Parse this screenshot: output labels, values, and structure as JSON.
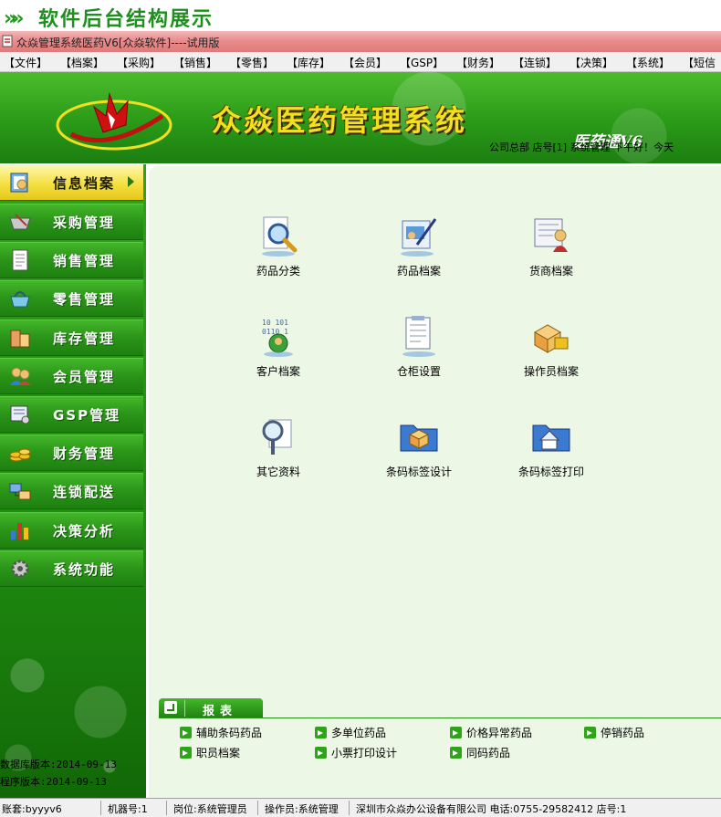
{
  "banner": {
    "chevrons": "»»",
    "title": "软件后台结构展示"
  },
  "window": {
    "title": "众焱管理系统医药V6[众焱软件]----试用版"
  },
  "menu": [
    "【文件】",
    "【档案】",
    "【采购】",
    "【销售】",
    "【零售】",
    "【库存】",
    "【会员】",
    "【GSP】",
    "【财务】",
    "【连锁】",
    "【决策】",
    "【系统】",
    "【短信"
  ],
  "header": {
    "system_name": "众焱医药管理系统",
    "edition": "医药通V6",
    "info": "公司总部  店号[1]  系统管理  下午好！今天"
  },
  "sidebar": {
    "items": [
      {
        "label": "信息档案",
        "icon": "archive-book-icon",
        "active": true
      },
      {
        "label": "采购管理",
        "icon": "shopping-basket-icon",
        "active": false
      },
      {
        "label": "销售管理",
        "icon": "document-icon",
        "active": false
      },
      {
        "label": "零售管理",
        "icon": "basket-icon",
        "active": false
      },
      {
        "label": "库存管理",
        "icon": "warehouse-icon",
        "active": false
      },
      {
        "label": "会员管理",
        "icon": "members-icon",
        "active": false
      },
      {
        "label": "GSP管理",
        "icon": "gsp-certificate-icon",
        "active": false
      },
      {
        "label": "财务管理",
        "icon": "coins-icon",
        "active": false
      },
      {
        "label": "连锁配送",
        "icon": "chain-delivery-icon",
        "active": false
      },
      {
        "label": "决策分析",
        "icon": "bar-chart-icon",
        "active": false
      },
      {
        "label": "系统功能",
        "icon": "gear-icon",
        "active": false
      }
    ],
    "db_version": "数据库版本:2014-09-13",
    "app_version": "程序版本:2014-09-13"
  },
  "main": {
    "functions": [
      {
        "label": "药品分类",
        "icon": "magnifier-document-icon"
      },
      {
        "label": "药品档案",
        "icon": "edit-document-icon"
      },
      {
        "label": "货商档案",
        "icon": "supplier-person-icon"
      },
      {
        "label": "客户档案",
        "icon": "customer-data-icon"
      },
      {
        "label": "仓柜设置",
        "icon": "clipboard-icon"
      },
      {
        "label": "操作员档案",
        "icon": "operator-boxes-icon"
      },
      {
        "label": "其它资料",
        "icon": "magnifier-icon"
      },
      {
        "label": "条码标签设计",
        "icon": "folder-cube-icon"
      },
      {
        "label": "条码标签打印",
        "icon": "folder-house-icon"
      }
    ]
  },
  "report": {
    "title": "报表",
    "links": [
      "辅助条码药品",
      "多单位药品",
      "价格异常药品",
      "停销药品",
      "职员档案",
      "小票打印设计",
      "同码药品"
    ]
  },
  "status": {
    "account": "账套:byyyv6",
    "machine": "机器号:1",
    "position": "岗位:系统管理员",
    "operator": "操作员:系统管理",
    "company": "深圳市众焱办公设备有限公司 电话:0755-29582412 店号:1"
  },
  "colors": {
    "accent_green": "#2a9418",
    "active_yellow": "#f4e040",
    "title_red": "#e07a7a",
    "panel_bg": "#ecf7e6"
  }
}
